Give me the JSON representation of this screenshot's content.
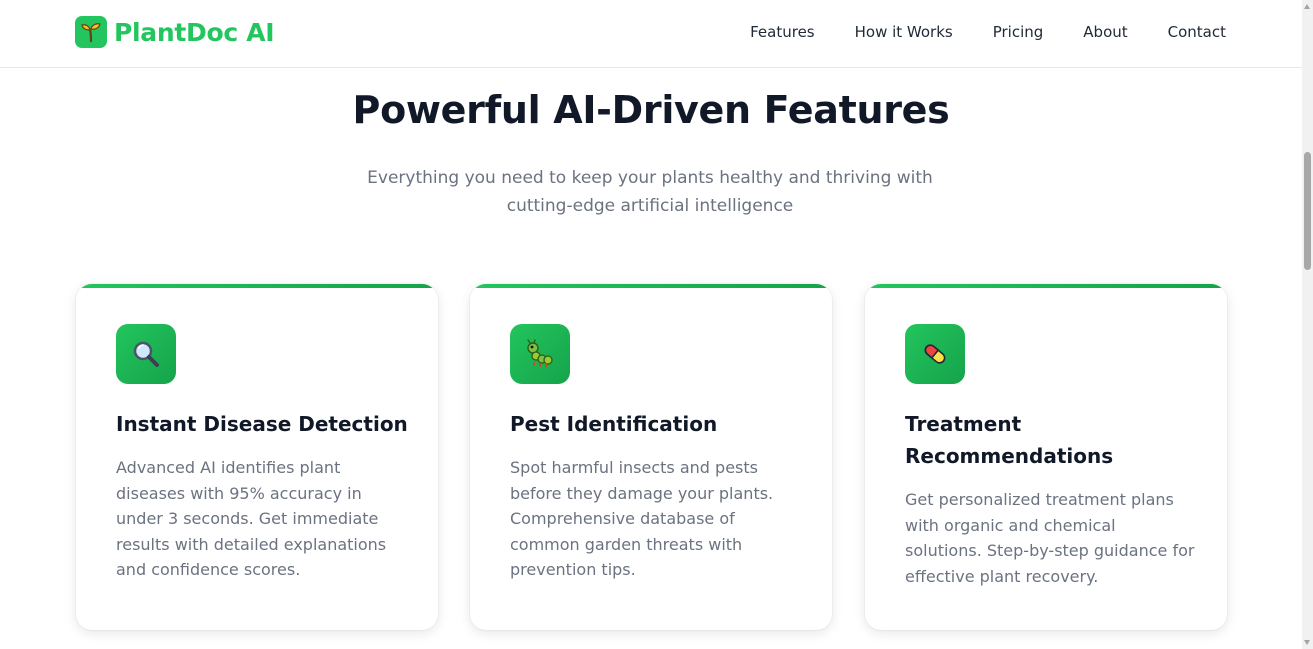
{
  "brand": {
    "name": "PlantDoc AI",
    "icon": "sprout-icon",
    "color": "#22c55e"
  },
  "nav": {
    "items": [
      "Features",
      "How it Works",
      "Pricing",
      "About",
      "Contact"
    ]
  },
  "hero": {
    "title": "Powerful AI-Driven Features",
    "subtitle": "Everything you need to keep your plants healthy and thriving with cutting-edge artificial intelligence"
  },
  "features": [
    {
      "icon": "magnifying-glass-icon",
      "title": "Instant Disease Detection",
      "description": "Advanced AI identifies plant diseases with 95% accuracy in under 3 seconds. Get immediate results with detailed explanations and confidence scores."
    },
    {
      "icon": "caterpillar-icon",
      "title": "Pest Identification",
      "description": "Spot harmful insects and pests before they damage your plants. Comprehensive database of common garden threats with prevention tips."
    },
    {
      "icon": "pill-icon",
      "title": "Treatment Recommendations",
      "description": "Get personalized treatment plans with organic and chemical solutions. Step-by-step guidance for effective plant recovery."
    }
  ],
  "colors": {
    "accent": "#22c55e",
    "accent_dark": "#16a34a",
    "heading": "#111827",
    "muted": "#6b7280"
  }
}
